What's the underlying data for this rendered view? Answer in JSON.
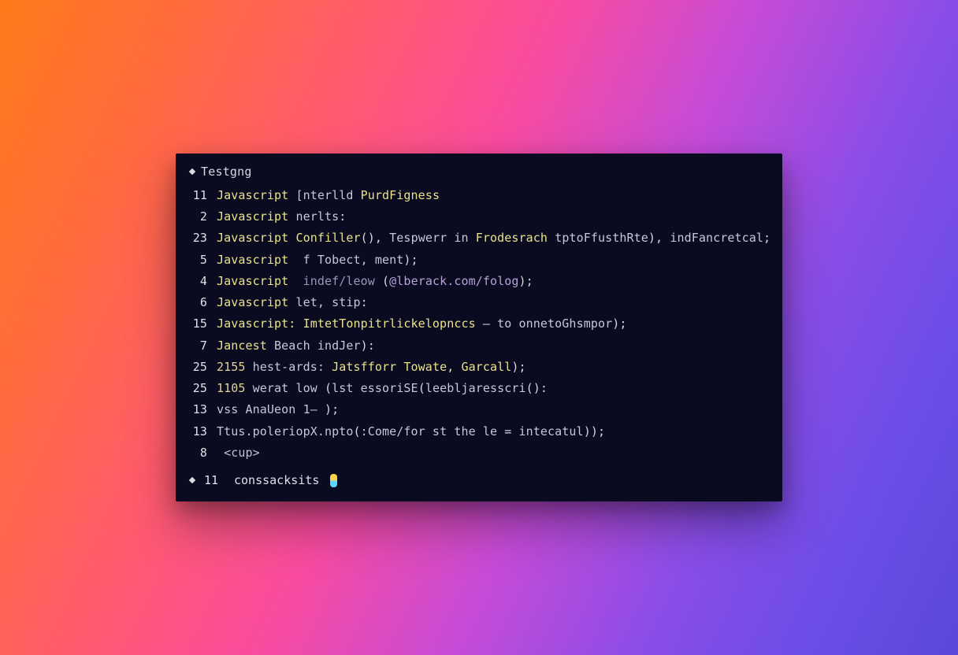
{
  "header": {
    "title": "Testgng"
  },
  "lines": [
    {
      "num": "11",
      "tokens": [
        {
          "cls": "t-kw",
          "text": "Javascript "
        },
        {
          "cls": "t-id",
          "text": "[nterlld "
        },
        {
          "cls": "t-fn",
          "text": "PurdFigness"
        }
      ]
    },
    {
      "num": "2",
      "tokens": [
        {
          "cls": "t-kw",
          "text": "Javascript "
        },
        {
          "cls": "t-id",
          "text": "nerlts"
        },
        {
          "cls": "t-punct",
          "text": ":"
        }
      ]
    },
    {
      "num": "23",
      "tokens": [
        {
          "cls": "t-kw",
          "text": "Javascript "
        },
        {
          "cls": "t-fn",
          "text": "Confiller"
        },
        {
          "cls": "t-punct",
          "text": "(), "
        },
        {
          "cls": "t-id",
          "text": "Tespwerr in "
        },
        {
          "cls": "t-fn",
          "text": "Frodesrach "
        },
        {
          "cls": "t-id",
          "text": "tptoFfusthRte"
        },
        {
          "cls": "t-punct",
          "text": "), "
        },
        {
          "cls": "t-id",
          "text": "indFancretcal"
        },
        {
          "cls": "t-punct",
          "text": ";"
        }
      ]
    },
    {
      "num": "5",
      "tokens": [
        {
          "cls": "t-kw",
          "text": "Javascript  "
        },
        {
          "cls": "t-id",
          "text": "f Tobect, ment"
        },
        {
          "cls": "t-punct",
          "text": ");"
        }
      ]
    },
    {
      "num": "4",
      "tokens": [
        {
          "cls": "t-kw",
          "text": "Javascript  "
        },
        {
          "cls": "t-dim",
          "text": "indef/leow "
        },
        {
          "cls": "t-punct",
          "text": "("
        },
        {
          "cls": "t-str",
          "text": "@lberack.com/folog"
        },
        {
          "cls": "t-punct",
          "text": ");"
        }
      ]
    },
    {
      "num": "6",
      "tokens": [
        {
          "cls": "t-kw",
          "text": "Javascript "
        },
        {
          "cls": "t-id",
          "text": "let, stip"
        },
        {
          "cls": "t-punct",
          "text": ":"
        }
      ]
    },
    {
      "num": "15",
      "tokens": [
        {
          "cls": "t-kw",
          "text": "Javascript: "
        },
        {
          "cls": "t-fn",
          "text": "ImtetTonpitrlickelopnccs "
        },
        {
          "cls": "t-op",
          "text": "— "
        },
        {
          "cls": "t-id",
          "text": "to onnetoGhsmpor"
        },
        {
          "cls": "t-punct",
          "text": ");"
        }
      ]
    },
    {
      "num": "7",
      "tokens": [
        {
          "cls": "t-kw",
          "text": "Jancest "
        },
        {
          "cls": "t-id",
          "text": "Beach indJer"
        },
        {
          "cls": "t-punct",
          "text": "):"
        }
      ]
    },
    {
      "num": "25",
      "tokens": [
        {
          "cls": "t-num",
          "text": "2155 "
        },
        {
          "cls": "t-id",
          "text": "hest-ards: "
        },
        {
          "cls": "t-fn",
          "text": "Jatsfforr Towate, Garcall"
        },
        {
          "cls": "t-punct",
          "text": ");"
        }
      ]
    },
    {
      "num": "25",
      "tokens": [
        {
          "cls": "t-num",
          "text": "1105 "
        },
        {
          "cls": "t-id",
          "text": "werat low "
        },
        {
          "cls": "t-punct",
          "text": "("
        },
        {
          "cls": "t-id",
          "text": "lst essoriSE"
        },
        {
          "cls": "t-punct",
          "text": "("
        },
        {
          "cls": "t-id",
          "text": "leebljaresscri"
        },
        {
          "cls": "t-punct",
          "text": "():"
        }
      ]
    },
    {
      "num": "13",
      "tokens": [
        {
          "cls": "t-id",
          "text": "vss AnaUeon 1— "
        },
        {
          "cls": "t-punct",
          "text": ");"
        }
      ]
    },
    {
      "num": "13",
      "tokens": [
        {
          "cls": "t-file",
          "text": "Ttus.poleriopX.npto"
        },
        {
          "cls": "t-punct",
          "text": "("
        },
        {
          "cls": "t-id",
          "text": ":Come/for st the le "
        },
        {
          "cls": "t-op",
          "text": "= "
        },
        {
          "cls": "t-id",
          "text": "intecatul"
        },
        {
          "cls": "t-punct",
          "text": "));"
        }
      ]
    },
    {
      "num": "8",
      "tokens": [
        {
          "cls": "t-punct",
          "text": " "
        },
        {
          "cls": "t-tag",
          "text": "<cup>"
        }
      ]
    }
  ],
  "footer": {
    "num": "11",
    "text": "conssacksits"
  }
}
